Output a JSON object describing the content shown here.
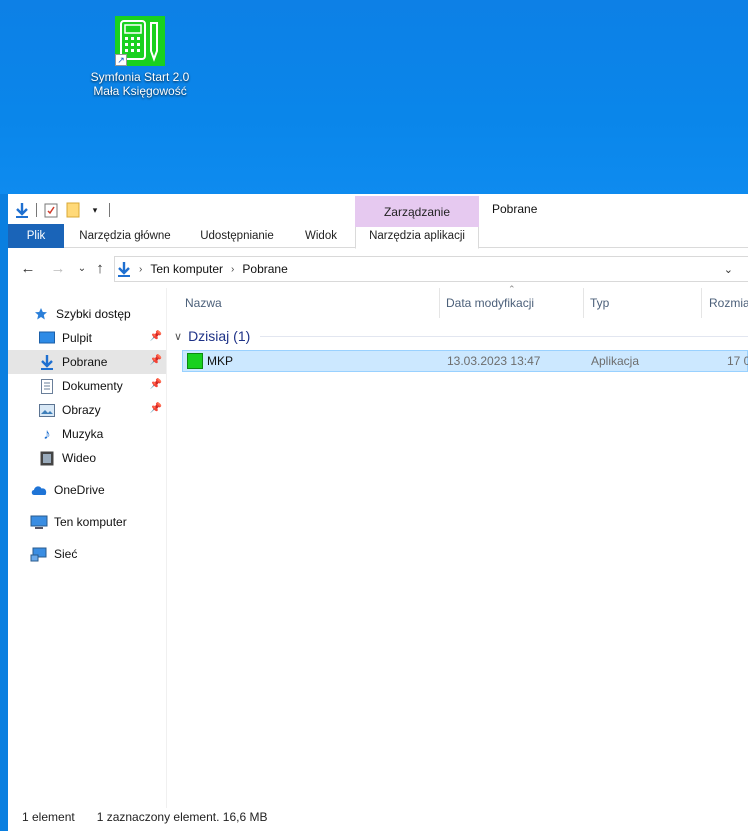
{
  "desktop": {
    "icon_label_line1": "Symfonia Start 2.0",
    "icon_label_line2": "Mała Księgowość",
    "icon_color": "#19d11f"
  },
  "window": {
    "title": "Pobrane",
    "context_tab_header": "Zarządzanie",
    "context_color": "#e6c9f0"
  },
  "ribbon": {
    "tabs": [
      {
        "label": "Plik"
      },
      {
        "label": "Narzędzia główne"
      },
      {
        "label": "Udostępnianie"
      },
      {
        "label": "Widok"
      },
      {
        "label": "Narzędzia aplikacji"
      }
    ],
    "file_tab_color": "#1a64b8"
  },
  "address": {
    "crumbs": [
      "Ten komputer",
      "Pobrane"
    ]
  },
  "navpane": {
    "items": [
      {
        "label": "Szybki dostęp",
        "icon": "star-icon"
      },
      {
        "label": "Pulpit",
        "icon": "desktop-icon"
      },
      {
        "label": "Pobrane",
        "icon": "download-icon"
      },
      {
        "label": "Dokumenty",
        "icon": "document-icon"
      },
      {
        "label": "Obrazy",
        "icon": "pictures-icon"
      },
      {
        "label": "Muzyka",
        "icon": "music-icon"
      },
      {
        "label": "Wideo",
        "icon": "video-icon"
      },
      {
        "label": "OneDrive",
        "icon": "cloud-icon"
      },
      {
        "label": "Ten komputer",
        "icon": "computer-icon"
      },
      {
        "label": "Sieć",
        "icon": "network-icon"
      }
    ]
  },
  "filelist": {
    "columns": [
      "Nazwa",
      "Data modyfikacji",
      "Typ",
      "Rozmia"
    ],
    "group_label": "Dzisiaj (1)",
    "rows": [
      {
        "name": "MKP",
        "date": "13.03.2023 13:47",
        "type": "Aplikacja",
        "size": "17 0"
      }
    ]
  },
  "status": {
    "count": "1 element",
    "selection": "1 zaznaczony element. 16,6 MB"
  }
}
